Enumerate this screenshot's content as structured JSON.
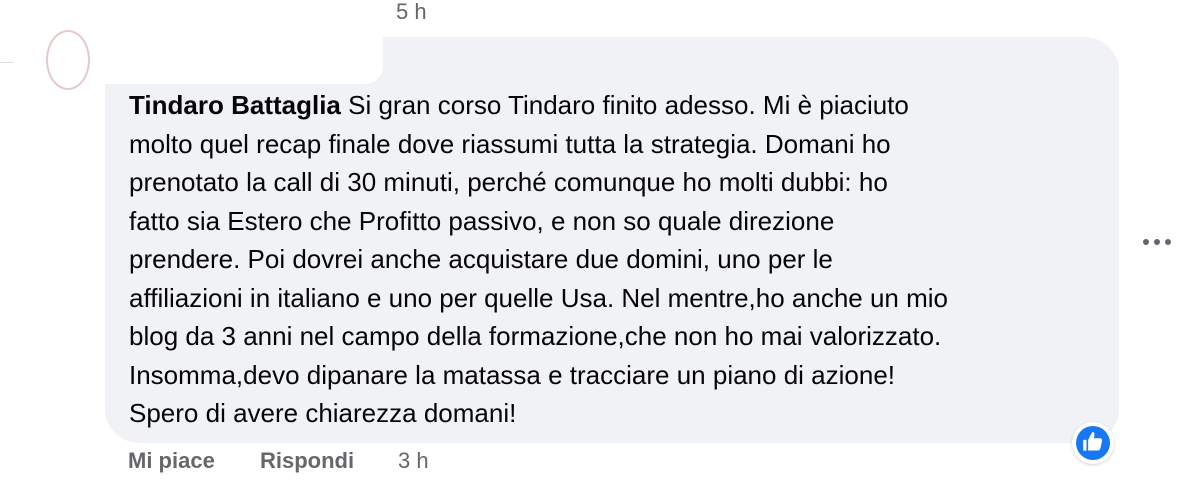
{
  "previous_comment": {
    "time": "5 h"
  },
  "comment": {
    "author": "Tindaro Battaglia",
    "text": "Si gran corso Tindaro finito adesso. Mi è piaciuto\nmolto quel recap finale dove riassumi tutta la strategia. Domani ho\nprenotato la call di 30 minuti, perché comunque ho molti dubbi: ho\nfatto sia Estero che Profitto passivo, e non so quale direzione\nprendere. Poi dovrei anche acquistare due domini, uno per le\naffiliazioni in italiano e uno per quelle Usa. Nel mentre,ho anche un mio\nblog da 3 anni nel campo della formazione,che non ho mai valorizzato.\nInsomma,devo dipanare la matassa e tracciare un piano di azione!\nSpero di avere chiarezza domani!",
    "reaction_icon": "like-thumb-icon",
    "more_icon": "more-options-icon"
  },
  "actions": {
    "like_label": "Mi piace",
    "reply_label": "Rispondi",
    "time": "3 h"
  },
  "colors": {
    "bubble_bg": "#f0f2f5",
    "secondary_text": "#65676b",
    "like_blue": "#1877f2"
  }
}
